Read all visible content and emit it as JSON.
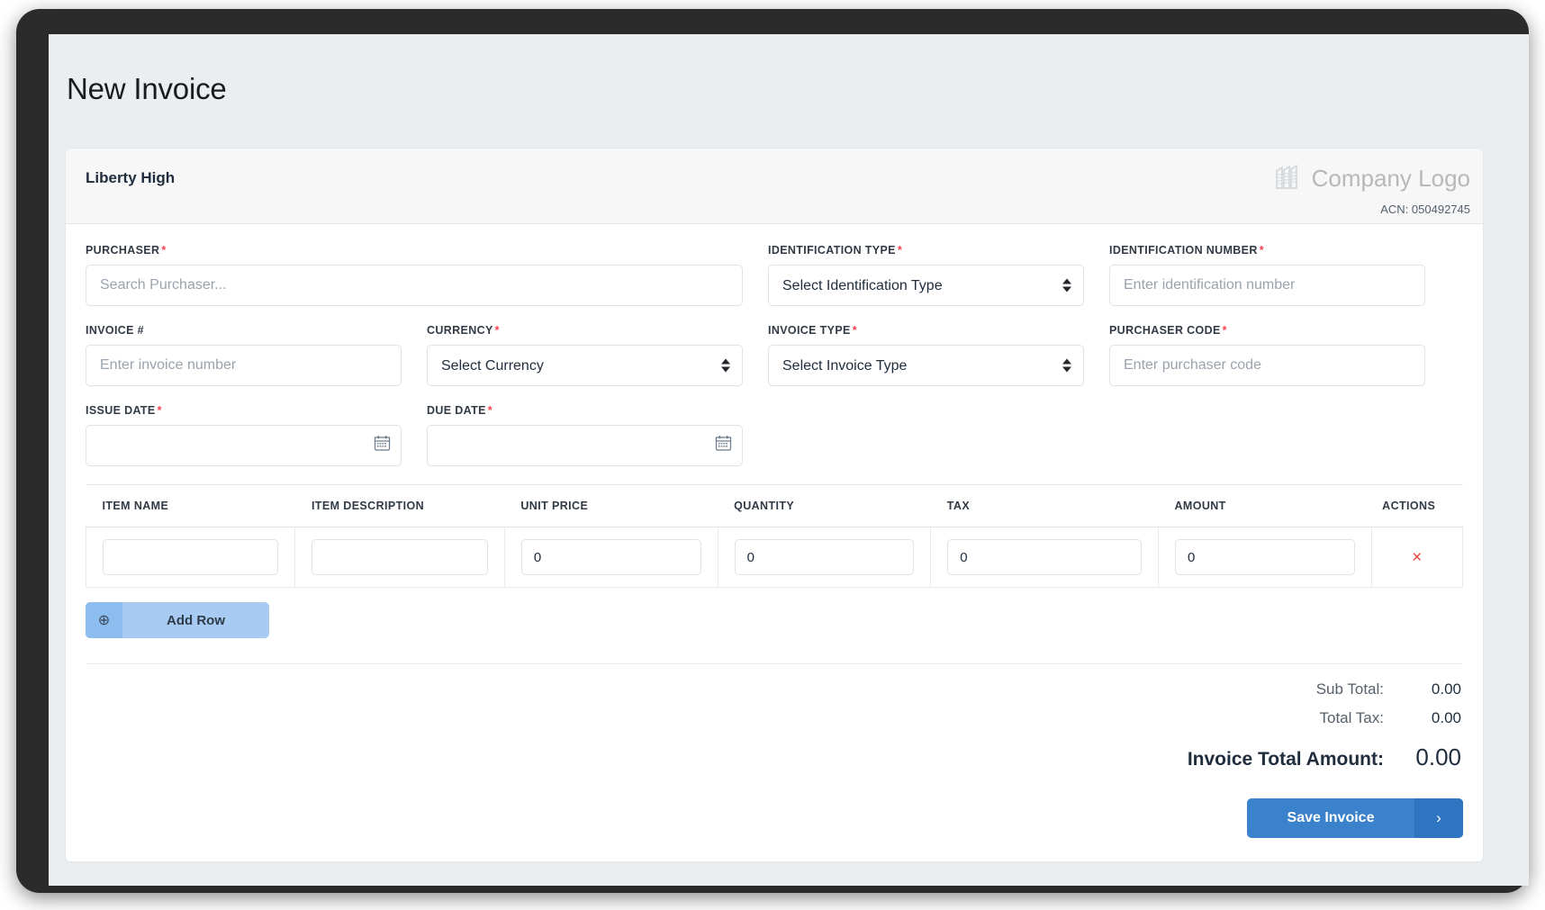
{
  "page": {
    "title": "New Invoice"
  },
  "card": {
    "org_name": "Liberty High",
    "logo_text": "Company Logo",
    "acn": "ACN: 050492745"
  },
  "form": {
    "purchaser": {
      "label": "PURCHASER",
      "required": "*",
      "placeholder": "Search Purchaser...",
      "value": ""
    },
    "identification_type": {
      "label": "IDENTIFICATION TYPE",
      "required": "*",
      "selected": "Select Identification Type"
    },
    "identification_number": {
      "label": "IDENTIFICATION NUMBER",
      "required": "*",
      "placeholder": "Enter identification number",
      "value": ""
    },
    "invoice_number": {
      "label": "INVOICE #",
      "required": "",
      "placeholder": "Enter invoice number",
      "value": ""
    },
    "currency": {
      "label": "CURRENCY",
      "required": "*",
      "selected": "Select Currency"
    },
    "invoice_type": {
      "label": "INVOICE TYPE",
      "required": "*",
      "selected": "Select Invoice Type"
    },
    "purchaser_code": {
      "label": "PURCHASER CODE",
      "required": "*",
      "placeholder": "Enter purchaser code",
      "value": ""
    },
    "issue_date": {
      "label": "ISSUE DATE",
      "required": "*",
      "placeholder": "",
      "value": "",
      "icon": "calendar-icon"
    },
    "due_date": {
      "label": "DUE DATE",
      "required": "*",
      "placeholder": "",
      "value": "",
      "icon": "calendar-icon"
    }
  },
  "items_table": {
    "headers": [
      "ITEM NAME",
      "ITEM DESCRIPTION",
      "UNIT PRICE",
      "QUANTITY",
      "TAX",
      "AMOUNT",
      "ACTIONS"
    ],
    "rows": [
      {
        "item_name": "",
        "item_description": "",
        "unit_price": "0",
        "quantity": "0",
        "tax": "0",
        "amount": "0",
        "delete_icon": "close-icon",
        "delete_glyph": "×"
      }
    ]
  },
  "add_row": {
    "label": "Add Row",
    "icon": "plus-circle-icon",
    "glyph": "⊕"
  },
  "totals": {
    "sub_total_label": "Sub Total:",
    "sub_total_value": "0.00",
    "total_tax_label": "Total Tax:",
    "total_tax_value": "0.00",
    "grand_label": "Invoice Total Amount:",
    "grand_value": "0.00"
  },
  "save": {
    "label": "Save Invoice",
    "icon": "chevron-right-icon",
    "glyph": "›"
  },
  "colors": {
    "accent_blue": "#3b82cc",
    "add_row_blue": "#a7cbf2",
    "required_red": "#f5424f",
    "delete_red": "#e8423f",
    "page_bg": "#eaeef1",
    "card_header_bg": "#f7f7f8"
  }
}
